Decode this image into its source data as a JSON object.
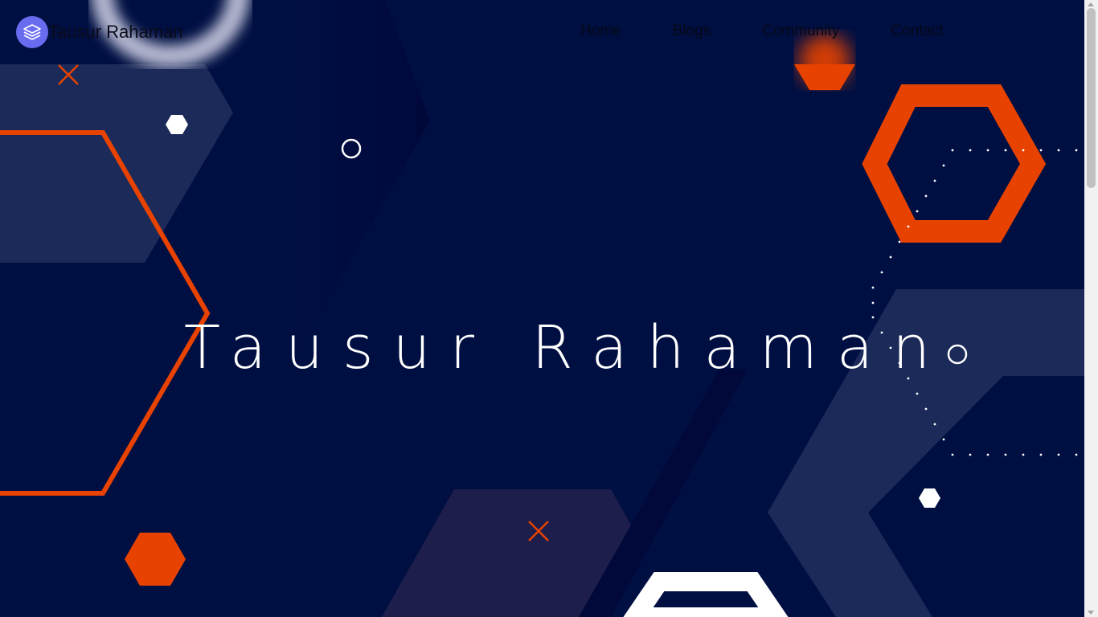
{
  "header": {
    "brand_name": "Tausur Rahaman",
    "logo_icon": "layers-icon"
  },
  "nav": {
    "items": [
      {
        "label": "Home"
      },
      {
        "label": "Blogs"
      },
      {
        "label": "Community"
      },
      {
        "label": "Contact"
      }
    ]
  },
  "hero": {
    "title": "Tausur Rahaman"
  },
  "colors": {
    "background": "#000f42",
    "accent": "#e84200",
    "logo": "#6a6cf0",
    "panel": "#1b2a58"
  }
}
